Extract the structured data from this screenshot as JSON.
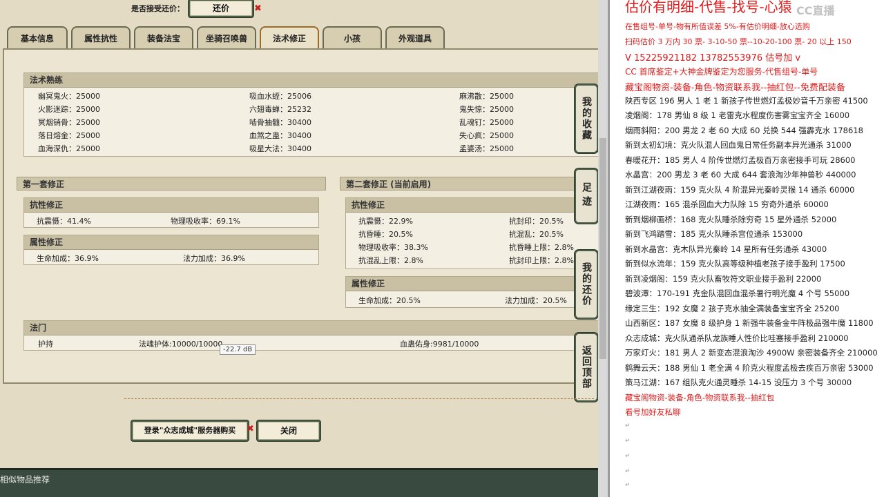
{
  "offer": {
    "label": "是否接受还价：",
    "button": "还价"
  },
  "tabs": [
    {
      "label": "基本信息"
    },
    {
      "label": "属性抗性"
    },
    {
      "label": "装备法宝"
    },
    {
      "label": "坐骑召唤兽"
    },
    {
      "label": "法术修正"
    },
    {
      "label": "小孩"
    },
    {
      "label": "外观道具"
    }
  ],
  "active_tab": "法术修正",
  "spells": {
    "title": "法术熟练",
    "rows": [
      [
        "幽冥鬼火：25000",
        "吸血水蛭：25006",
        "麻沸散：25000"
      ],
      [
        "火影迷踪：25000",
        "六翅毒蝉：25232",
        "鬼失惊：25000"
      ],
      [
        "冥烟销骨：25000",
        "啮骨抽髓：30400",
        "乱魂钉：25000"
      ],
      [
        "落日熔金：25000",
        "血煞之蛊：30400",
        "失心疯：25000"
      ],
      [
        "血海深仇：25000",
        "吸星大法：30400",
        "孟婆汤：25000"
      ]
    ]
  },
  "set1": {
    "title": "第一套修正",
    "resist": {
      "title": "抗性修正",
      "items": [
        "抗震慑：41.4%",
        "物理吸收率：69.1%"
      ]
    },
    "attr": {
      "title": "属性修正",
      "items": [
        "生命加成：36.9%",
        "法力加成：36.9%"
      ]
    }
  },
  "set2": {
    "title": "第二套修正 (当前启用)",
    "resist": {
      "title": "抗性修正",
      "rows": [
        [
          "抗震慑：22.9%",
          "抗封印：20.5%"
        ],
        [
          "抗昏睡：20.5%",
          "抗混乱：20.5%"
        ],
        [
          "物理吸收率：38.3%",
          "抗昏睡上限：2.8%"
        ],
        [
          "抗混乱上限：2.8%",
          "抗封印上限：2.8%"
        ]
      ]
    },
    "attr": {
      "title": "属性修正",
      "items": [
        "生命加成：20.5%",
        "法力加成：20.5%"
      ]
    }
  },
  "fameng": {
    "title": "法门",
    "items": [
      "护持",
      "法魂护体:10000/10000",
      "血蛊佑身:9981/10000"
    ]
  },
  "tooltip": "-22.7 dB",
  "side_tabs": [
    "我的收藏",
    "足迹",
    "我的还价",
    "返回顶部"
  ],
  "buttons": {
    "login": "登录\"众志成城\"服务器购买",
    "close": "关闭"
  },
  "bottom": "相似物品推荐",
  "doc": {
    "title": "估价有明细-代售-找号-心猿",
    "watermark": "CC直播",
    "lines": [
      {
        "t": "在售组号-单号-物有所值误差 5%-有估价明细-放心选购",
        "c": "red"
      },
      {
        "t": "扫码估价 3 万内 30 票- 3-10-50 票--10-20-100 票- 20 以上 150",
        "c": "red"
      },
      {
        "t": "V 15225921182   13782553976   估号加 v",
        "c": "red"
      },
      {
        "t": "CC 首席鉴定+大神金牌鉴定为您服务-代售组号-单号",
        "c": "red"
      },
      {
        "t": "藏宝阁物资-装备-角色-物资联系我--抽红包--免费配装备",
        "c": "red"
      },
      {
        "t": "陕西专区 196 男人 1 老 1 新孩子传世燃灯孟极妙音千万亲密 41500",
        "c": "blk"
      },
      {
        "t": "凌烟阁：178 男仙 8 级 1 老雷克水程度伤害雾宝宝齐全 16000",
        "c": "blk"
      },
      {
        "t": "烟雨斜阳：200 男龙 2 老 60 大成 60 兑换 544 强霹克水 178618",
        "c": "blk"
      },
      {
        "t": "新到太初幻境：克火队混人回血鬼日常任务副本异光通杀 31000",
        "c": "blk"
      },
      {
        "t": "春暖花开：185 男人 4 阶传世燃灯孟极百万亲密接手可玩 28600",
        "c": "blk"
      },
      {
        "t": "水晶宫：200 男龙 3 老 60 大成 644 套浪淘沙年神兽秒 440000",
        "c": "blk"
      },
      {
        "t": "新到江湖夜雨：159 克火队 4 阶混异光秦岭灵猴 14 通杀 60000",
        "c": "blk"
      },
      {
        "t": "江湖夜雨：165 混杀回血大力队除 15 穷奇外通杀 60000",
        "c": "blk"
      },
      {
        "t": "新到烟柳画桥：168 克火队睡杀除穷奇 15 星外通杀 52000",
        "c": "blk"
      },
      {
        "t": "新到飞鸿踏雪：185 克火队睡杀宫位通杀 153000",
        "c": "blk"
      },
      {
        "t": "新到水晶宫：克木队异光秦岭 14 星所有任务通杀 43000",
        "c": "blk"
      },
      {
        "t": "新到似水流年：159 克火队高等级种植老孩子接手盈利 17500",
        "c": "blk"
      },
      {
        "t": "新到凌烟阁：159 克火队畜牧符文职业接手盈利 22000",
        "c": "blk"
      },
      {
        "t": "碧波潭：170-191 克金队混回血混杀暑行明光魔 4 个号 55000",
        "c": "blk"
      },
      {
        "t": "缘定三生：192 女魔 2 孩子克水抽全满装备宝宝齐全 25200",
        "c": "blk"
      },
      {
        "t": "山西新区：187 女魔 8 级护身 1 新强牛装备金牛阵极品强牛魔 11800",
        "c": "blk"
      },
      {
        "t": "众志成城：克火队通杀队龙族睡人性价比哇塞接手盈利 210000",
        "c": "blk"
      },
      {
        "t": "万家灯火：181 男人 2 新变态混浪淘沙 4900W 亲密装备齐全 210000",
        "c": "blk"
      },
      {
        "t": "鹤舞云天：188 男仙 1 老全满 4 阶克火程度孟极去疾百万亲密 53000",
        "c": "blk"
      },
      {
        "t": "策马江湖：167 组队克火通灵睡杀 14-15 没压力 3 个号 30000",
        "c": "blk"
      },
      {
        "t": "藏宝阁物资-装备-角色-物资联系我--抽红包",
        "c": "red"
      },
      {
        "t": "看号加好友私聊",
        "c": "red"
      }
    ]
  }
}
